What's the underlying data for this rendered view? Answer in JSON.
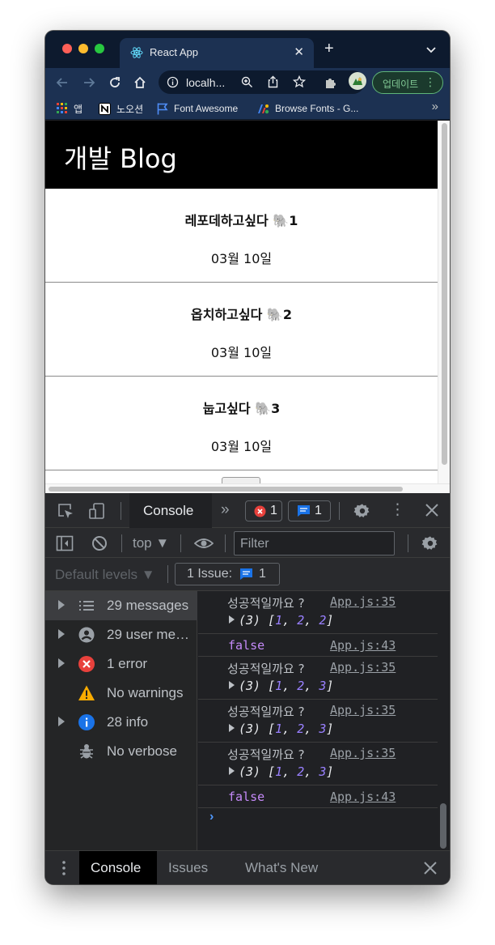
{
  "browser": {
    "tab_title": "React App",
    "url": "localh...",
    "update_label": "업데이트",
    "bookmarks": [
      {
        "label": "앱",
        "icon": "apps-grid-icon"
      },
      {
        "label": "노오션",
        "icon": "notion-icon"
      },
      {
        "label": "Font Awesome",
        "icon": "flag-icon"
      },
      {
        "label": "Browse Fonts - G...",
        "icon": "google-fonts-icon"
      }
    ],
    "more_bookmarks": "»"
  },
  "page": {
    "nav_title": "개발 Blog",
    "posts": [
      {
        "title": "레포데하고싶다 🐘1",
        "date": "03월 10일"
      },
      {
        "title": "옵치하고싶다 🐘2",
        "date": "03월 10일"
      },
      {
        "title": "눕고싶다 🐘3",
        "date": "03월 10일"
      }
    ]
  },
  "devtools": {
    "active_tab": "Console",
    "more_tabs": "»",
    "error_count": "1",
    "message_count": "1",
    "context": "top ▼",
    "filter_placeholder": "Filter",
    "levels": "Default levels ▼",
    "issues_label": "1 Issue:",
    "issues_count": "1",
    "sidebar": [
      {
        "label": "29 messages",
        "icon": "list-icon",
        "expandable": true,
        "active": true
      },
      {
        "label": "29 user me…",
        "icon": "user-icon",
        "expandable": true
      },
      {
        "label": "1 error",
        "icon": "error-icon",
        "expandable": true
      },
      {
        "label": "No warnings",
        "icon": "warning-icon",
        "expandable": false
      },
      {
        "label": "28 info",
        "icon": "info-icon",
        "expandable": true
      },
      {
        "label": "No verbose",
        "icon": "bug-icon",
        "expandable": false
      }
    ],
    "logs": [
      {
        "kind": "array",
        "message": "성공적일까요 ?",
        "link": "App.js:35",
        "array_len": "(3)",
        "values": [
          "1",
          "2",
          "2"
        ]
      },
      {
        "kind": "bool",
        "message": "false",
        "link": "App.js:43"
      },
      {
        "kind": "array",
        "message": "성공적일까요 ?",
        "link": "App.js:35",
        "array_len": "(3)",
        "values": [
          "1",
          "2",
          "3"
        ]
      },
      {
        "kind": "array",
        "message": "성공적일까요 ?",
        "link": "App.js:35",
        "array_len": "(3)",
        "values": [
          "1",
          "2",
          "3"
        ]
      },
      {
        "kind": "array",
        "message": "성공적일까요 ?",
        "link": "App.js:35",
        "array_len": "(3)",
        "values": [
          "1",
          "2",
          "3"
        ]
      },
      {
        "kind": "bool",
        "message": "false",
        "link": "App.js:43"
      }
    ],
    "prompt": "›",
    "drawer_tabs": [
      "Console",
      "Issues",
      "What's New"
    ]
  },
  "colors": {
    "tab_strip": "#0d1a2e",
    "toolbar": "#1c3152",
    "update_accent": "#81c995",
    "error_red": "#e8413c",
    "info_blue": "#1a73e8",
    "warning_yellow": "#f9ab00",
    "array_number": "#9980ff",
    "bool_purple": "#c58af9"
  }
}
